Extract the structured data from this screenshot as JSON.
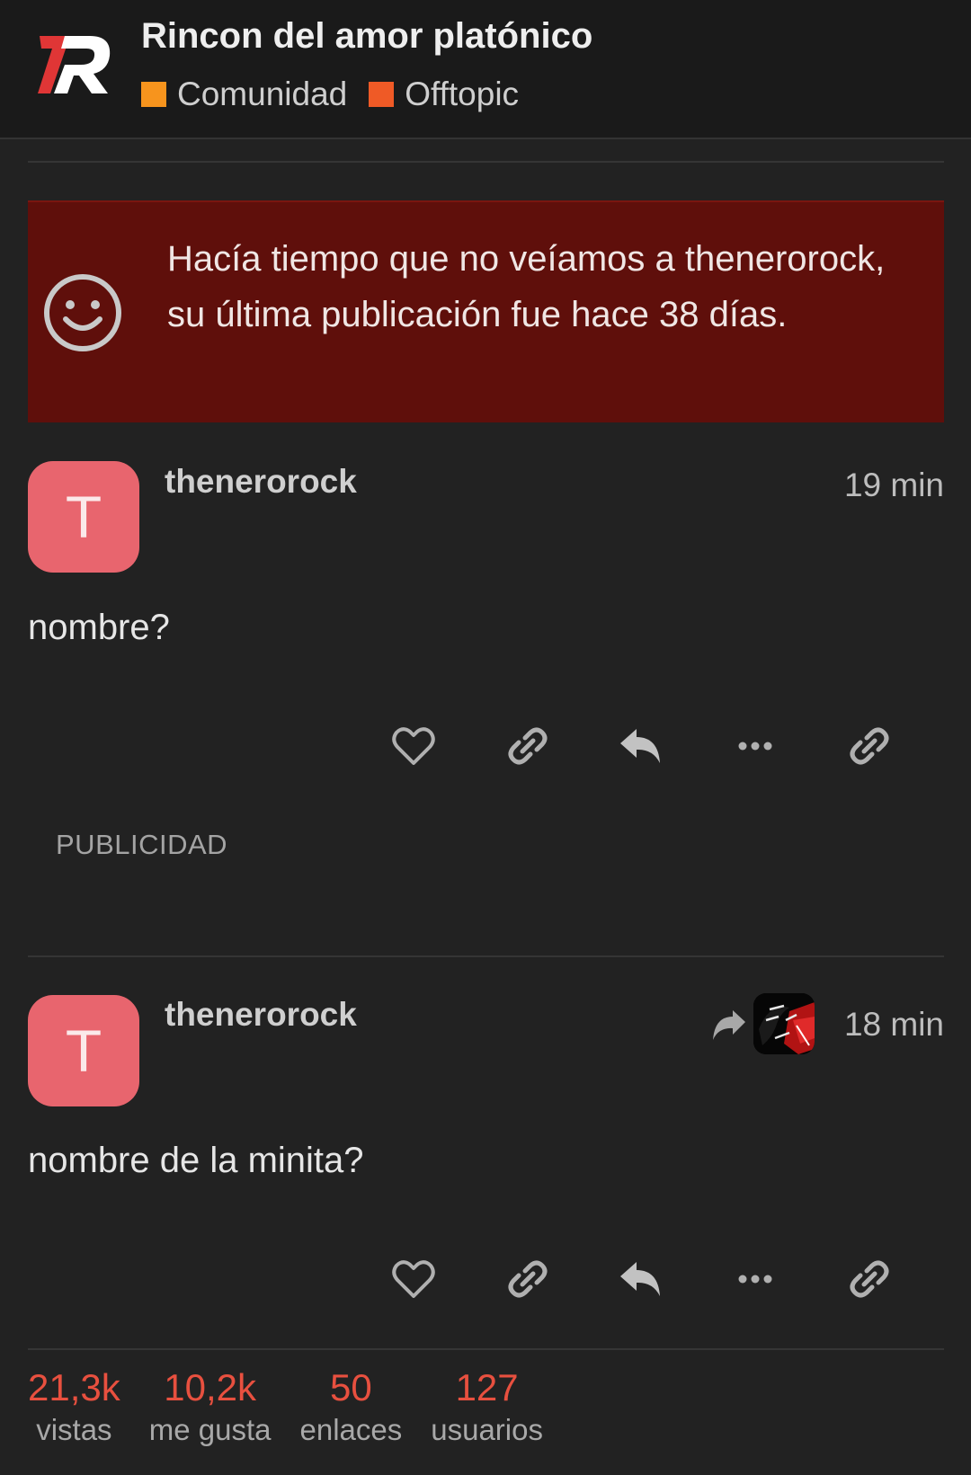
{
  "header": {
    "title": "Rincon del amor platónico",
    "categories": [
      {
        "label": "Comunidad",
        "color": "#f7941d"
      },
      {
        "label": "Offtopic",
        "color": "#ef5a26"
      }
    ]
  },
  "notice": {
    "text": "Hacía tiempo que no veíamos a thenerorock, su última publicación fue hace 38 días.",
    "icon": "smiley-icon",
    "background": "#5f0f0b"
  },
  "posts": [
    {
      "avatar_letter": "T",
      "username": "thenerorock",
      "time": "19 min",
      "body": "nombre?"
    },
    {
      "avatar_letter": "T",
      "username": "thenerorock",
      "time": "18 min",
      "body": "nombre de la minita?"
    }
  ],
  "post_actions": [
    "heart-icon",
    "link-icon",
    "reply-icon",
    "more-icon",
    "link-icon"
  ],
  "ad": {
    "label": "PUBLICIDAD"
  },
  "stats": [
    {
      "value": "21,3k",
      "label": "vistas"
    },
    {
      "value": "10,2k",
      "label": "me gusta"
    },
    {
      "value": "50",
      "label": "enlaces"
    },
    {
      "value": "127",
      "label": "usuarios"
    }
  ],
  "colors": {
    "accent": "#e8503f",
    "avatar": "#e8656e",
    "background": "#222222"
  }
}
